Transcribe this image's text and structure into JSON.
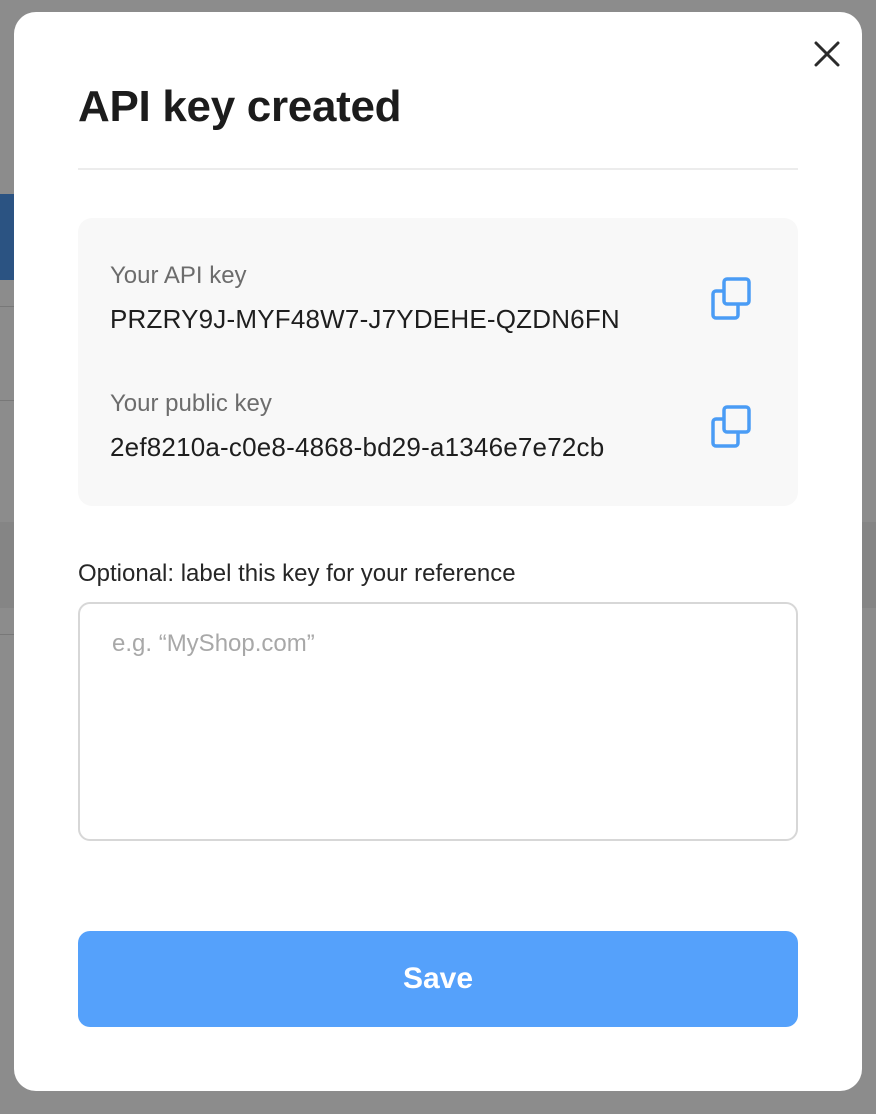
{
  "modal": {
    "title": "API key created",
    "api_key": {
      "label": "Your API key",
      "value": "PRZRY9J-MYF48W7-J7YDEHE-QZDN6FN",
      "copy_icon": "copy-icon"
    },
    "public_key": {
      "label": "Your public key",
      "value": "2ef8210a-c0e8-4868-bd29-a1346e7e72cb",
      "copy_icon": "copy-icon"
    },
    "label_field": {
      "prompt": "Optional: label this key for your reference",
      "placeholder": "e.g. “MyShop.com”",
      "value": ""
    },
    "save_label": "Save",
    "close_icon": "close-icon"
  },
  "colors": {
    "accent": "#55a1fb",
    "copy_icon": "#4a9cf5",
    "overlay_dim": "rgba(0,0,0,0.42)"
  }
}
